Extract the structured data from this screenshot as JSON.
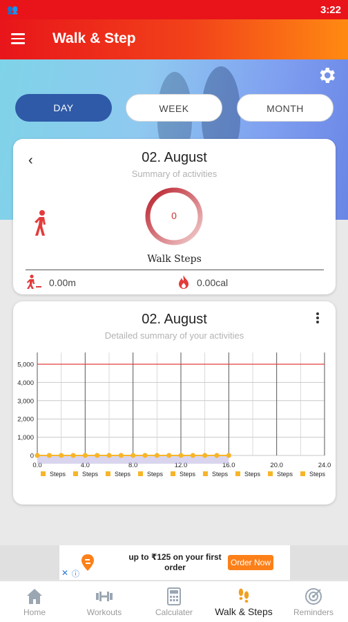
{
  "status_bar": {
    "time": "3:22"
  },
  "app_bar": {
    "title": "Walk & Step"
  },
  "period_tabs": [
    {
      "label": "DAY",
      "active": true
    },
    {
      "label": "WEEK",
      "active": false
    },
    {
      "label": "MONTH",
      "active": false
    }
  ],
  "summary_card": {
    "date": "02. August",
    "subtitle": "Summary of activities",
    "steps_value": "0",
    "steps_label": "Walk Steps",
    "distance": "0.00m",
    "calories": "0.00cal"
  },
  "detail_card": {
    "date": "02. August",
    "subtitle": "Detailed summary of your activities"
  },
  "chart_data": {
    "type": "line",
    "x": [
      0,
      1,
      2,
      3,
      4,
      5,
      6,
      7,
      8,
      9,
      10,
      11,
      12,
      13,
      14,
      15,
      16
    ],
    "series": [
      {
        "name": "Steps",
        "values": [
          0,
          0,
          0,
          0,
          0,
          0,
          0,
          0,
          0,
          0,
          0,
          0,
          0,
          0,
          0,
          0,
          0
        ],
        "color": "#f7b52a"
      }
    ],
    "goal_line": 5000,
    "goal_color": "#e23c3c",
    "xlim": [
      0,
      24
    ],
    "ylim": [
      0,
      5000
    ],
    "x_ticks": [
      "0.0",
      "4.0",
      "8.0",
      "12.0",
      "16.0",
      "20.0",
      "24.0"
    ],
    "y_ticks": [
      "0",
      "1,000",
      "2,000",
      "3,000",
      "4,000",
      "5,000"
    ],
    "legend": [
      "Steps",
      "Steps",
      "Steps",
      "Steps",
      "Steps",
      "Steps",
      "Steps",
      "Steps",
      "Steps"
    ],
    "legend_position": "bottom",
    "grid": true
  },
  "ad": {
    "text": "up to ₹125 on your first order",
    "button": "Order Now",
    "close": "✕",
    "choices": "ⓘ"
  },
  "bottom_nav": [
    {
      "label": "Home",
      "icon": "home-icon",
      "active": false
    },
    {
      "label": "Workouts",
      "icon": "dumbbell-icon",
      "active": false
    },
    {
      "label": "Calculater",
      "icon": "calculator-icon",
      "active": false
    },
    {
      "label": "Walk & Steps",
      "icon": "footsteps-icon",
      "active": true
    },
    {
      "label": "Reminders",
      "icon": "target-icon",
      "active": false
    }
  ],
  "colors": {
    "accent": "#e8141a",
    "tab_active": "#2f5aa8",
    "ring": "#c33a3a"
  }
}
